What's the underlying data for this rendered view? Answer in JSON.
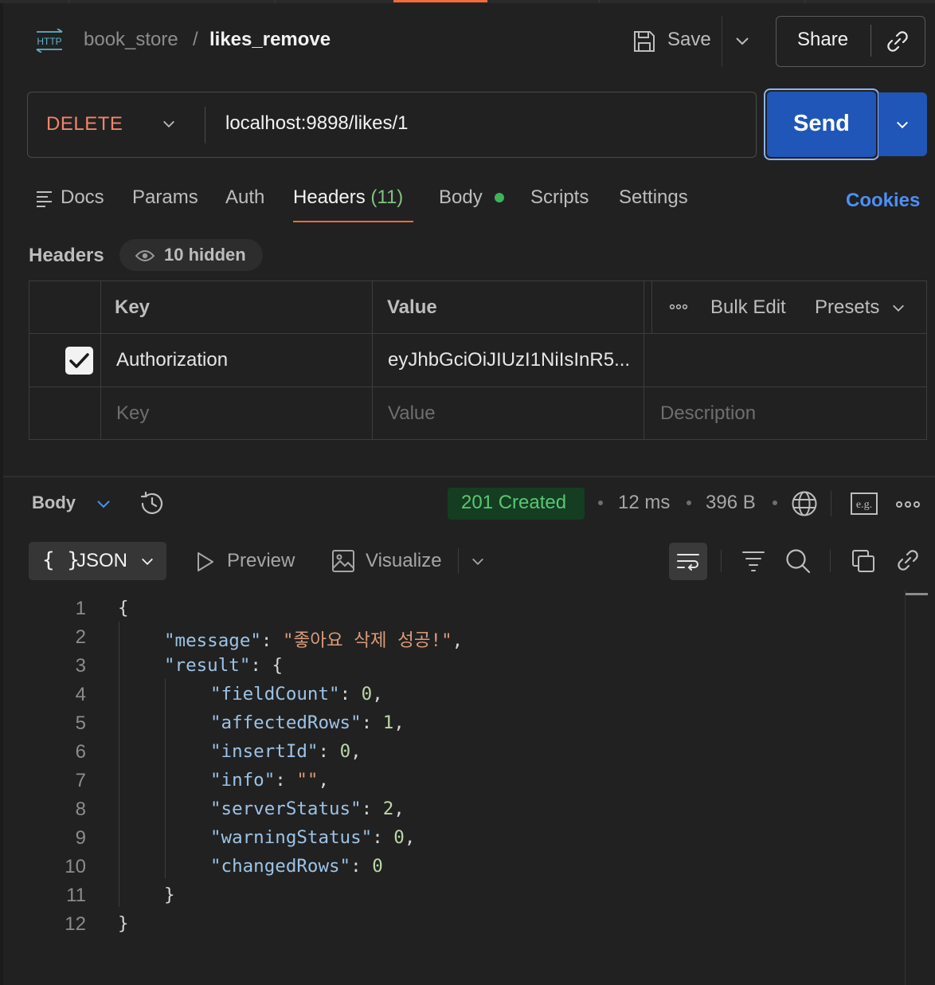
{
  "header": {
    "collection": "book_store",
    "separator": "/",
    "request_name": "likes_remove",
    "save_label": "Save",
    "share_label": "Share",
    "http_badge": "HTTP"
  },
  "request": {
    "method": "DELETE",
    "url": "localhost:9898/likes/1",
    "send_label": "Send"
  },
  "tabs": {
    "docs": "Docs",
    "params": "Params",
    "auth": "Auth",
    "headers": "Headers",
    "headers_count": "(11)",
    "body": "Body",
    "scripts": "Scripts",
    "settings": "Settings",
    "cookies": "Cookies"
  },
  "headers_section": {
    "title": "Headers",
    "hidden_label": "10 hidden",
    "columns": {
      "key": "Key",
      "value": "Value",
      "bulk_edit": "Bulk Edit",
      "presets": "Presets"
    },
    "rows": [
      {
        "checked": true,
        "key": "Authorization",
        "value": "eyJhbGciOiJIUzI1NiIsInR5..."
      }
    ],
    "placeholders": {
      "key": "Key",
      "value": "Value",
      "description": "Description"
    }
  },
  "response": {
    "body_label": "Body",
    "status": "201 Created",
    "time": "12 ms",
    "size": "396 B",
    "eg_label": "e.g.",
    "format_label": "JSON",
    "format_braces": "{ }",
    "preview_label": "Preview",
    "visualize_label": "Visualize",
    "line_numbers": [
      "1",
      "2",
      "3",
      "4",
      "5",
      "6",
      "7",
      "8",
      "9",
      "10",
      "11",
      "12"
    ],
    "json": {
      "open_brace": "{",
      "message_key": "\"message\"",
      "message_value": "\"좋아요 삭제 성공!\"",
      "result_key": "\"result\"",
      "result_open": "{",
      "fields": [
        {
          "key": "\"fieldCount\"",
          "value": "0",
          "comma": ","
        },
        {
          "key": "\"affectedRows\"",
          "value": "1",
          "comma": ","
        },
        {
          "key": "\"insertId\"",
          "value": "0",
          "comma": ","
        },
        {
          "key": "\"info\"",
          "value": "\"\"",
          "comma": ","
        },
        {
          "key": "\"serverStatus\"",
          "value": "2",
          "comma": ","
        },
        {
          "key": "\"warningStatus\"",
          "value": "0",
          "comma": ","
        },
        {
          "key": "\"changedRows\"",
          "value": "0",
          "comma": ""
        }
      ],
      "result_close": "}",
      "close_brace": "}"
    }
  },
  "colors": {
    "accent": "#f26b3a",
    "send": "#1f56b8",
    "method": "#f0856b",
    "status_ok": "#5ac76f",
    "link": "#4d8ff5"
  }
}
